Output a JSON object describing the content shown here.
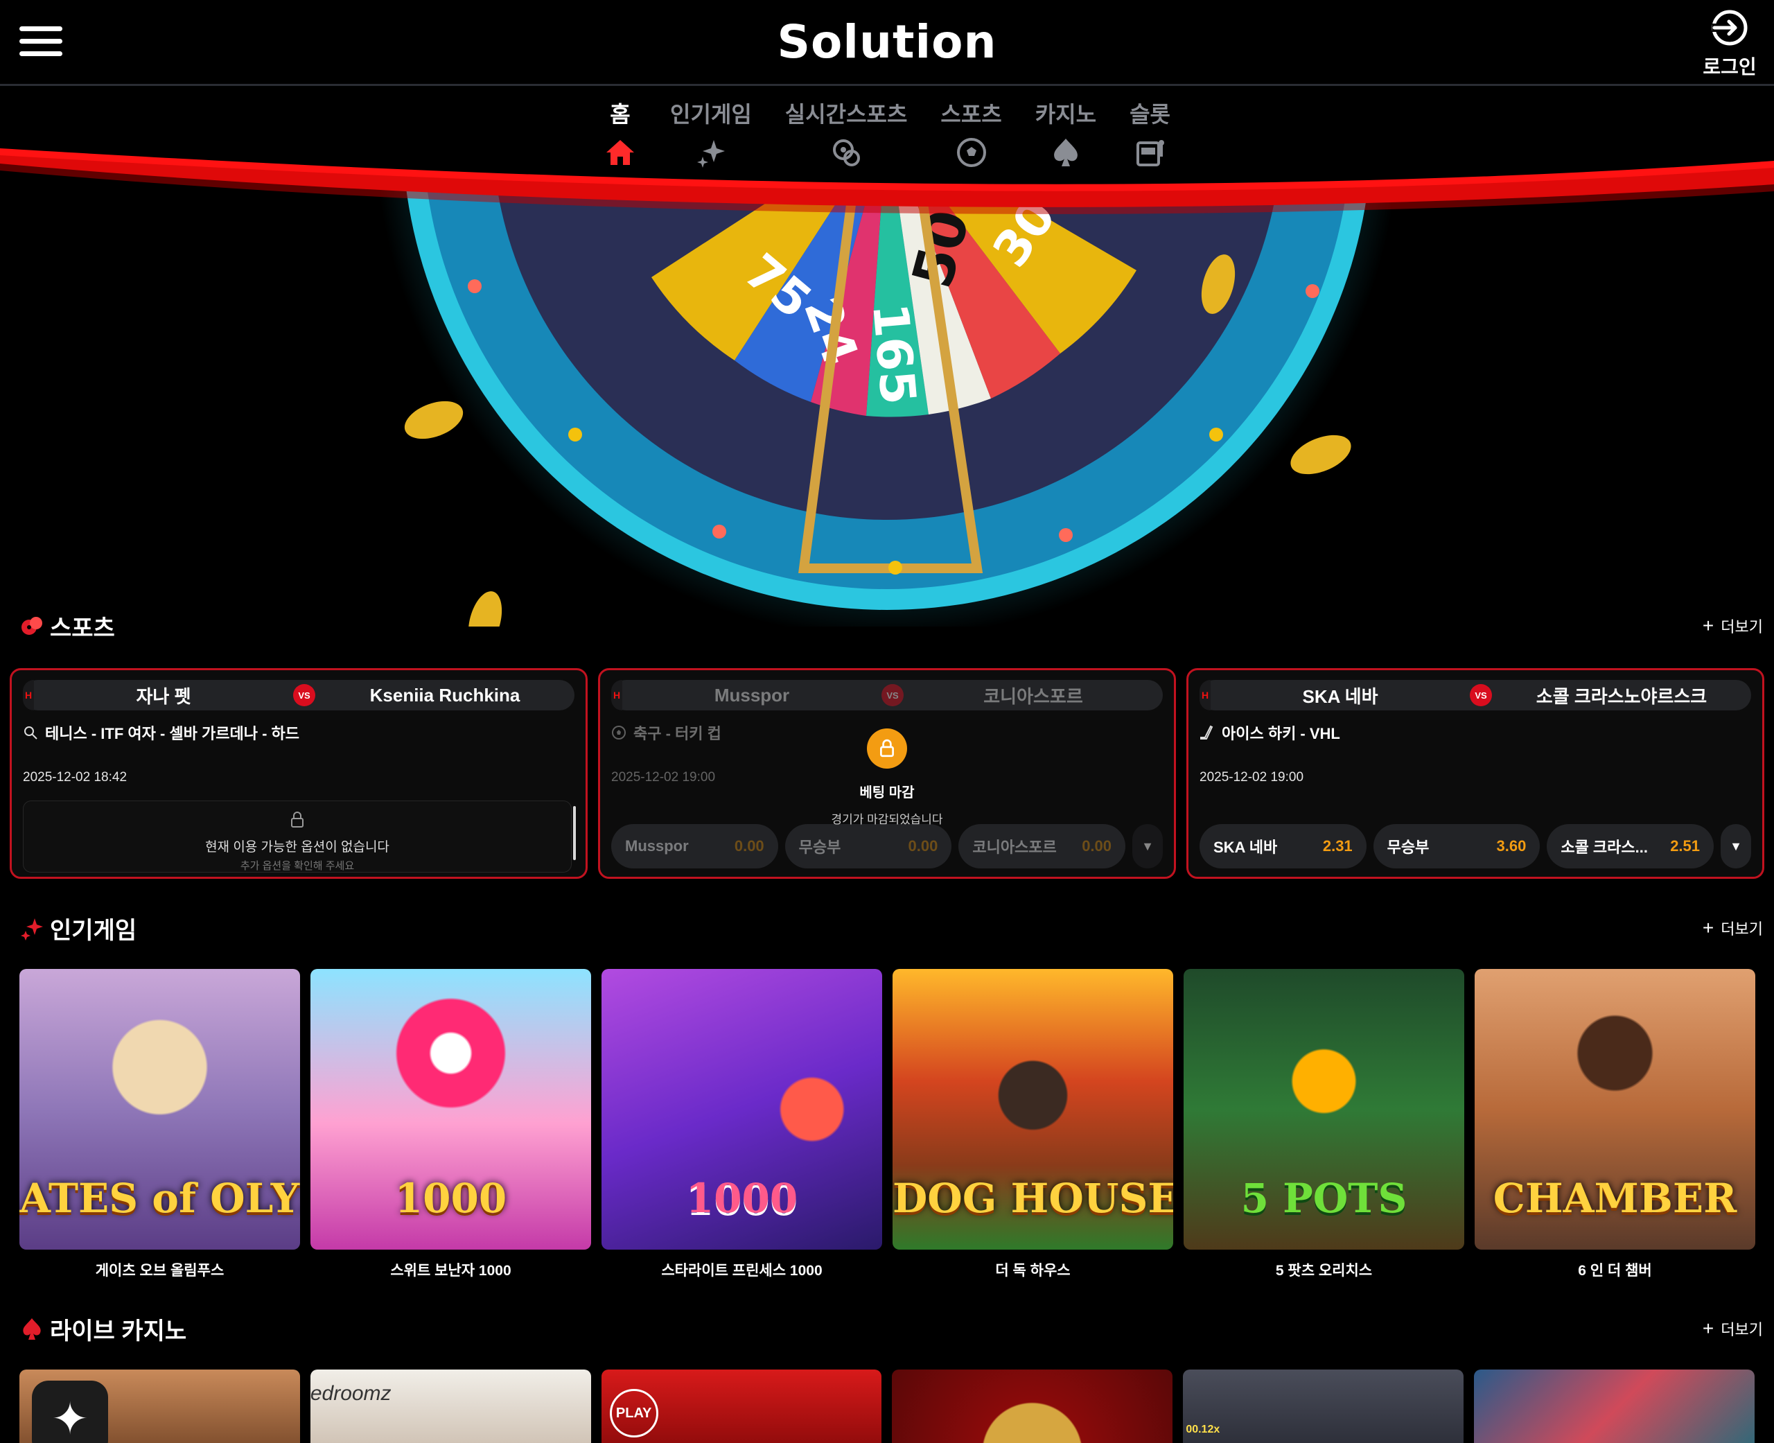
{
  "header": {
    "logo": "Solution",
    "login_label": "로그인"
  },
  "nav": [
    {
      "label": "홈",
      "icon": "home-icon",
      "active": true
    },
    {
      "label": "인기게임",
      "icon": "sparkles-icon"
    },
    {
      "label": "실시간스포츠",
      "icon": "live-sports-icon"
    },
    {
      "label": "스포츠",
      "icon": "soccer-ball-icon"
    },
    {
      "label": "카지노",
      "icon": "spade-icon"
    },
    {
      "label": "슬롯",
      "icon": "slot-machine-icon"
    }
  ],
  "sports": {
    "title": "스포츠",
    "more": "더보기",
    "matches": [
      {
        "home": "자나 펫",
        "away": "Kseniia Ruchkina",
        "vs": "VS",
        "badge": "H",
        "league": "테니스 -  ITF 여자 - 셀바 가르데나 - 하드",
        "league_icon": "tennis-icon",
        "date": "2025-12-02 18:42",
        "no_options_title": "현재 이용 가능한 옵션이 없습니다",
        "no_options_sub": "추가 옵션을 확인해 주세요"
      },
      {
        "home": "Musspor",
        "away": "코니아스포르",
        "vs": "VS",
        "badge": "H",
        "league": "축구 -  터키 컵",
        "league_icon": "soccer-icon",
        "date": "2025-12-02 19:00",
        "closed_title": "베팅 마감",
        "closed_sub": "경기가 마감되었습니다",
        "odds": [
          {
            "name": "Musspor",
            "value": "0.00"
          },
          {
            "name": "무승부",
            "value": "0.00"
          },
          {
            "name": "코니아스포르",
            "value": "0.00"
          }
        ]
      },
      {
        "home": "SKA 네바",
        "away": "소콜 크라스노야르스크",
        "vs": "VS",
        "badge": "H",
        "league": "아이스 하키 -  VHL",
        "league_icon": "hockey-icon",
        "date": "2025-12-02 19:00",
        "odds": [
          {
            "name": "SKA 네바",
            "value": "2.31"
          },
          {
            "name": "무승부",
            "value": "3.60"
          },
          {
            "name": "소콜 크라스...",
            "value": "2.51"
          }
        ]
      }
    ]
  },
  "popular": {
    "title": "인기게임",
    "more": "더보기",
    "games": [
      {
        "name": "게이츠 오브 올림푸스",
        "art": "ATES of OLYMPU"
      },
      {
        "name": "스위트 보난자 1000",
        "art": "1000"
      },
      {
        "name": "스타라이트 프린세스 1000",
        "art": "1000"
      },
      {
        "name": "더 독 하우스",
        "art": "DOG HOUSE"
      },
      {
        "name": "5 팟츠 오리치스",
        "art": "5 POTS"
      },
      {
        "name": "6 인 더 챔버",
        "art": "CHAMBER"
      }
    ]
  },
  "live": {
    "title": "라이브 카지노",
    "more": "더보기",
    "tiles": [
      {
        "caption": ""
      },
      {
        "caption": "edroomz"
      },
      {
        "caption": "PLAY"
      },
      {
        "caption": ""
      },
      {
        "caption": "00.12x"
      },
      {
        "caption": ""
      }
    ]
  },
  "colors": {
    "accent": "#d90d1e",
    "odds": "#f39c12",
    "card_border": "#c1121f"
  }
}
